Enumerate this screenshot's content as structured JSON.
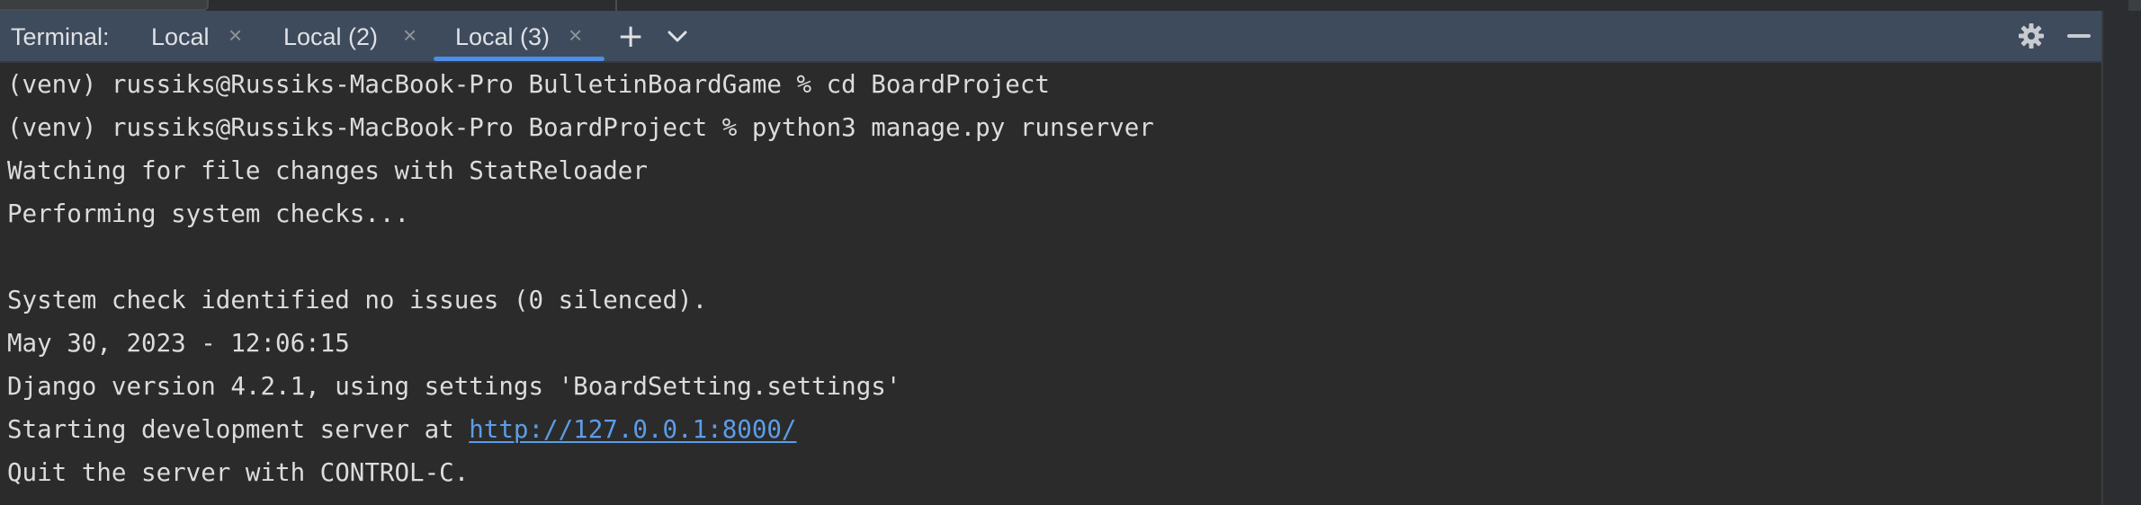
{
  "terminal_panel": {
    "label": "Terminal:",
    "tabs": [
      {
        "label": "Local",
        "close": "×",
        "active": false
      },
      {
        "label": "Local (2)",
        "close": "×",
        "active": false
      },
      {
        "label": "Local (3)",
        "close": "×",
        "active": true
      }
    ],
    "add_tab_symbol": "+",
    "icons": {
      "dropdown": "chevron-down-icon",
      "settings": "gear-icon",
      "minimize": "minimize-icon"
    },
    "colors": {
      "tabbar_bg": "#3d4b5c",
      "terminal_bg": "#2b2b2b",
      "text": "#dcdcdc",
      "link": "#5c9de8",
      "active_tab_underline": "#4c8ee8"
    }
  },
  "terminal": {
    "lines": [
      {
        "text": "(venv) russiks@Russiks-MacBook-Pro BulletinBoardGame % cd BoardProject"
      },
      {
        "text": "(venv) russiks@Russiks-MacBook-Pro BoardProject % python3 manage.py runserver"
      },
      {
        "text": "Watching for file changes with StatReloader"
      },
      {
        "text": "Performing system checks..."
      },
      {
        "text": ""
      },
      {
        "text": "System check identified no issues (0 silenced)."
      },
      {
        "text": "May 30, 2023 - 12:06:15"
      },
      {
        "text": "Django version 4.2.1, using settings 'BoardSetting.settings'"
      },
      {
        "prefix": "Starting development server at ",
        "link": "http://127.0.0.1:8000/"
      },
      {
        "text": "Quit the server with CONTROL-C."
      }
    ]
  }
}
